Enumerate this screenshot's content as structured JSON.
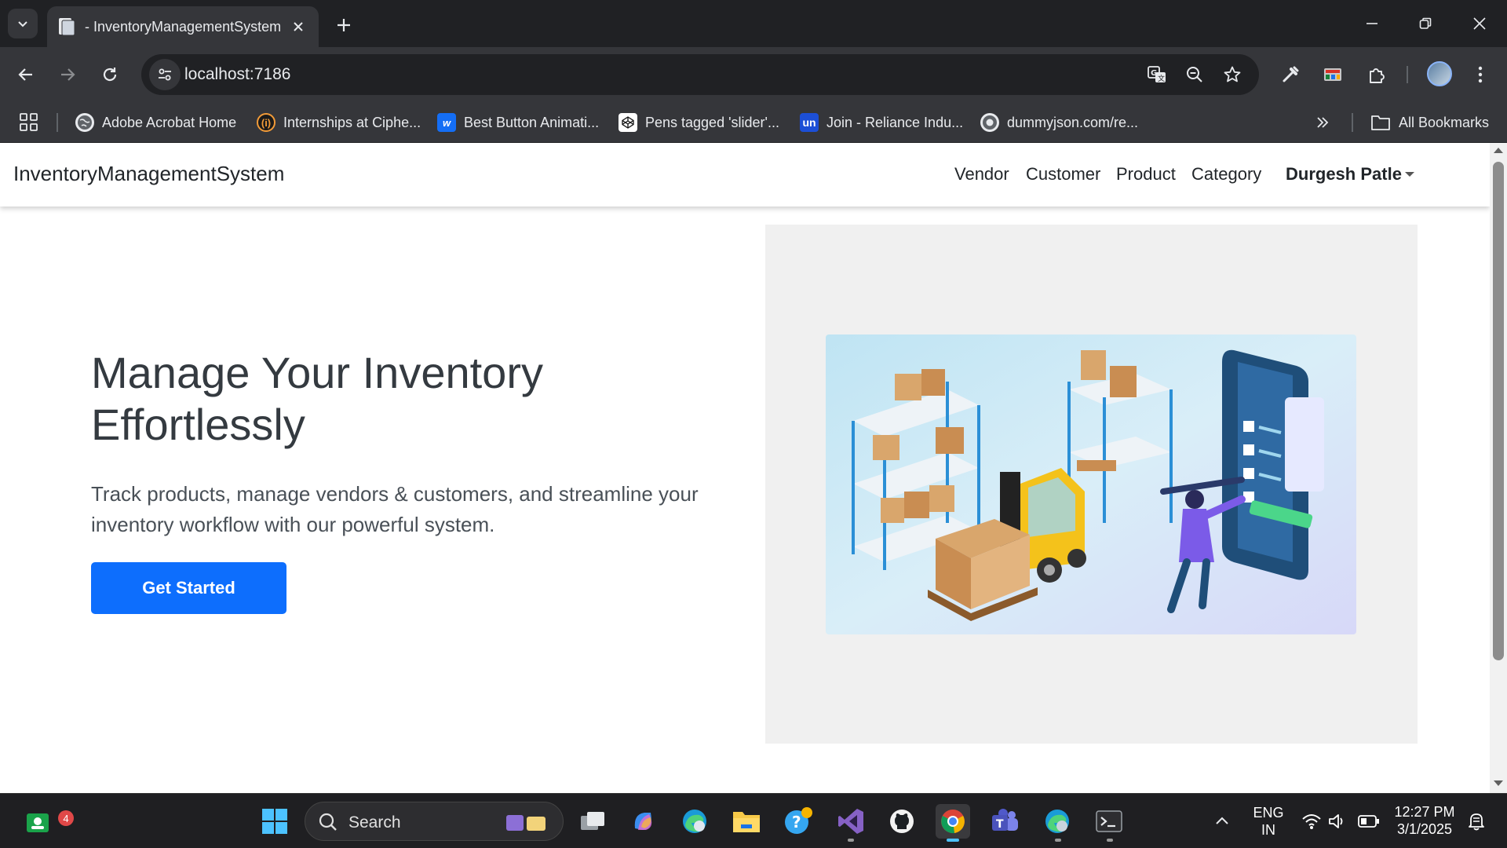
{
  "browser": {
    "tab": {
      "title": "- InventoryManagementSystem"
    },
    "omnibox": {
      "url": "localhost:7186"
    },
    "bookmarks": [
      {
        "label": "Adobe Acrobat Home",
        "icon": "globe-icon"
      },
      {
        "label": "Internships at Ciphe...",
        "icon": "cipher-icon"
      },
      {
        "label": "Best Button Animati...",
        "icon": "webflow-icon"
      },
      {
        "label": "Pens tagged 'slider'...",
        "icon": "codepen-icon"
      },
      {
        "label": "Join - Reliance Indu...",
        "icon": "unstop-icon"
      },
      {
        "label": "dummyjson.com/re...",
        "icon": "globe-icon"
      }
    ],
    "all_bookmarks_label": "All Bookmarks"
  },
  "site": {
    "brand": "InventoryManagementSystem",
    "nav": [
      "Vendor",
      "Customer",
      "Product",
      "Category"
    ],
    "user": "Durgesh Patle",
    "hero": {
      "title_line1": "Manage Your Inventory",
      "title_line2": "Effortlessly",
      "description": "Track products, manage vendors & customers, and streamline your inventory workflow with our powerful system.",
      "cta": "Get Started"
    },
    "colors": {
      "primary": "#0d6efd",
      "panel_bg": "#f0f0f0"
    }
  },
  "taskbar": {
    "search_label": "Search",
    "notification_count": "4",
    "language_line1": "ENG",
    "language_line2": "IN",
    "time": "12:27 PM",
    "date": "3/1/2025"
  }
}
